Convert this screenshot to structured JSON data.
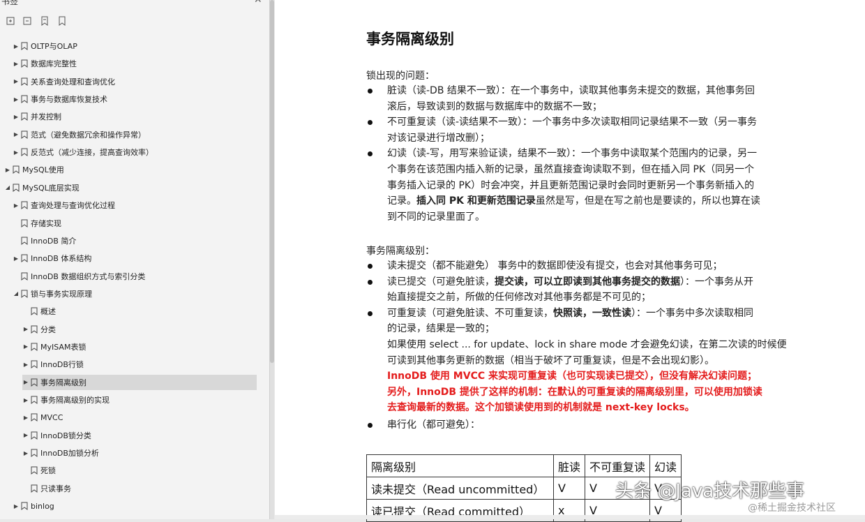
{
  "sidebar": {
    "title": "书签",
    "close_icon": "close-icon",
    "toolbar_icons": [
      "expand-all-icon",
      "collapse-all-icon",
      "add-bookmark-icon",
      "bookmark-icon"
    ],
    "items": [
      {
        "label": "OLTP与OLAP",
        "arrow": "▶",
        "level": 1
      },
      {
        "label": "数据库完整性",
        "arrow": "▶",
        "level": 1
      },
      {
        "label": "关系查询处理和查询优化",
        "arrow": "▶",
        "level": 1
      },
      {
        "label": "事务与数据库恢复技术",
        "arrow": "▶",
        "level": 1
      },
      {
        "label": "并发控制",
        "arrow": "▶",
        "level": 1
      },
      {
        "label": "范式（避免数据冗余和操作异常）",
        "arrow": "▶",
        "level": 1
      },
      {
        "label": "反范式（减少连接，提高查询效率）",
        "arrow": "▶",
        "level": 1
      },
      {
        "label": "MySQL使用",
        "arrow": "▶",
        "level": 0
      },
      {
        "label": "MySQL底层实现",
        "arrow": "◢",
        "level": 0
      },
      {
        "label": "查询处理与查询优化过程",
        "arrow": "▶",
        "level": 1
      },
      {
        "label": "存储实现",
        "arrow": "",
        "level": 1
      },
      {
        "label": "InnoDB 简介",
        "arrow": "",
        "level": 1
      },
      {
        "label": "InnoDB 体系结构",
        "arrow": "▶",
        "level": 1
      },
      {
        "label": "InnoDB 数据组织方式与索引分类",
        "arrow": "",
        "level": 1
      },
      {
        "label": "锁与事务实现原理",
        "arrow": "◢",
        "level": 1
      },
      {
        "label": "概述",
        "arrow": "",
        "level": 2
      },
      {
        "label": "分类",
        "arrow": "▶",
        "level": 2
      },
      {
        "label": "MyISAM表锁",
        "arrow": "▶",
        "level": 2
      },
      {
        "label": "InnoDB行锁",
        "arrow": "▶",
        "level": 2
      },
      {
        "label": "事务隔离级别",
        "arrow": "▶",
        "level": 2,
        "selected": true
      },
      {
        "label": "事务隔离级别的实现",
        "arrow": "▶",
        "level": 2
      },
      {
        "label": "MVCC",
        "arrow": "▶",
        "level": 2
      },
      {
        "label": "InnoDB锁分类",
        "arrow": "▶",
        "level": 2
      },
      {
        "label": "InnoDB加锁分析",
        "arrow": "▶",
        "level": 2
      },
      {
        "label": "死锁",
        "arrow": "",
        "level": 2
      },
      {
        "label": "只读事务",
        "arrow": "",
        "level": 2
      },
      {
        "label": "binlog",
        "arrow": "▶",
        "level": 1
      }
    ]
  },
  "doc": {
    "title": "事务隔离级别",
    "sec1_heading": "锁出现的问题：",
    "sec1_lines": [
      [
        {
          "t": "脏读（读-DB 结果不一致）：在一个事务中，读取其他事务未提交的数据，其他事务回"
        }
      ],
      [
        {
          "t": "滚后，导致读到的数据与数据库中的数据不一致；"
        }
      ],
      [
        {
          "t": "不可重复读（读-读结果不一致）：一个事务中多次读取相同记录结果不一致（另一事务"
        }
      ],
      [
        {
          "t": "对该记录进行增改删）；"
        }
      ],
      [
        {
          "t": "幻读（读-写，用写来验证读，结果不一致）：一个事务中读取某个范围内的记录，另一"
        }
      ],
      [
        {
          "t": "个事务在该范围内插入新的记录，虽然直接查询读取不到，但在插入同 PK（同另一个"
        }
      ],
      [
        {
          "t": "事务插入记录的 PK）时会冲突，并且更新范围记录时会同时更新另一个事务新插入的"
        }
      ],
      [
        {
          "t": "记录。"
        },
        {
          "t": "插入同 PK 和更新范围记录",
          "b": true
        },
        {
          "t": "虽然是写，但是在写之前也是要读的，所以也算在读"
        }
      ],
      [
        {
          "t": "到不同的记录里面了。"
        }
      ]
    ],
    "sec2_heading": "事务隔离级别：",
    "sec2_lines": [
      [
        {
          "t": "读未提交（都不能避免）   事务中的数据即使没有提交，也会对其他事务可见；"
        }
      ],
      [
        {
          "t": "读已提交（可避免脏读，"
        },
        {
          "t": "提交读，可以立即读到其他事务提交的数据",
          "b": true
        },
        {
          "t": "）：一个事务从开"
        }
      ],
      [
        {
          "t": "始直接提交之前，所做的任何修改对其他事务都是不可见的；"
        }
      ],
      [
        {
          "t": "可重复读（可避免脏读、不可重复读，"
        },
        {
          "t": "快照读，一致性读",
          "b": true
        },
        {
          "t": "）：一个事务中多次读取相同"
        }
      ],
      [
        {
          "t": "的记录，结果是一致的；"
        }
      ],
      [
        {
          "t": "如果使用 select ... for update、lock in share mode 才会避免幻读，在第二次读的时候便"
        }
      ],
      [
        {
          "t": "可读到其他事务更新的数据（相当于破坏了可重复读，但是不会出现幻影）。"
        }
      ],
      [
        {
          "t": "InnoDB 使用 MVCC 来实现可重复读（也可实现读已提交），但没有解决幻读问题；",
          "r": true
        }
      ],
      [
        {
          "t": "另外，InnoDB 提供了这样的机制：在默认的可重复读的隔离级别里，可以使用加锁读",
          "r": true
        }
      ],
      [
        {
          "t": "去查询最新的数据。这个加锁读使用到的机制就是 next-key locks。",
          "r": true
        }
      ],
      [
        {
          "t": "串行化（都可避免）："
        }
      ]
    ],
    "table": {
      "headers": [
        "隔离级别",
        "脏读",
        "不可重复读",
        "幻读"
      ],
      "rows": [
        [
          "读未提交（Read uncommitted）",
          "V",
          "V",
          "V"
        ],
        [
          "读已提交（Read committed）",
          "x",
          "V",
          "V"
        ]
      ]
    },
    "watermark": "头条 @Java技术那些事",
    "watermark2": "@稀土掘金技术社区"
  }
}
